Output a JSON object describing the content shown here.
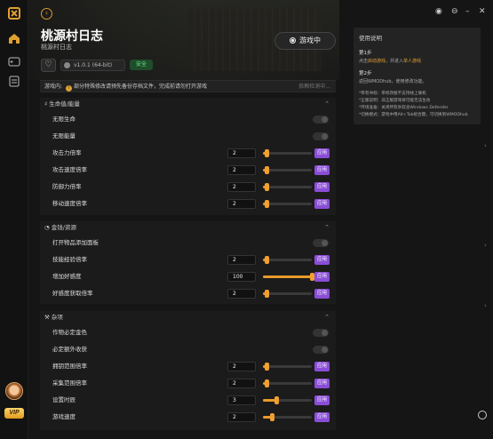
{
  "app": {
    "title": "桃源村日志",
    "subtitle": "桃源村日志",
    "play_button": "游戏中",
    "version": "v1.0.1 (64-bit)",
    "secure_badge": "安全",
    "vip_label": "VIP"
  },
  "notice": {
    "label": "游戏内:",
    "text": "部分特殊修改请预先备份存档文件，完成前请勿打开游戏",
    "status": "依赖检测中..."
  },
  "sections": [
    {
      "title": "生命值/能量",
      "rows": [
        {
          "label": "无限生命",
          "type": "toggle"
        },
        {
          "label": "无限能量",
          "type": "toggle"
        },
        {
          "label": "攻击力倍率",
          "type": "slider",
          "value": "2",
          "fraction": 0.08,
          "apply": "应用"
        },
        {
          "label": "攻击速度倍率",
          "type": "slider",
          "value": "2",
          "fraction": 0.08,
          "apply": "应用"
        },
        {
          "label": "防御力倍率",
          "type": "slider",
          "value": "2",
          "fraction": 0.08,
          "apply": "应用"
        },
        {
          "label": "移动速度倍率",
          "type": "slider",
          "value": "2",
          "fraction": 0.08,
          "apply": "应用"
        }
      ]
    },
    {
      "title": "金钱/资源",
      "rows": [
        {
          "label": "打开物品添加面板",
          "type": "toggle"
        },
        {
          "label": "技能经验倍率",
          "type": "slider",
          "value": "2",
          "fraction": 0.08,
          "apply": "应用"
        },
        {
          "label": "增加好感度",
          "type": "slider",
          "value": "100",
          "fraction": 1.0,
          "apply": "应用"
        },
        {
          "label": "好感度获取倍率",
          "type": "slider",
          "value": "2",
          "fraction": 0.08,
          "apply": "应用"
        }
      ]
    },
    {
      "title": "杂项",
      "rows": [
        {
          "label": "作物必定金色",
          "type": "toggle"
        },
        {
          "label": "必定额外收获",
          "type": "toggle"
        },
        {
          "label": "拥钥范围倍率",
          "type": "slider",
          "value": "2",
          "fraction": 0.08,
          "apply": "应用"
        },
        {
          "label": "采集范围倍率",
          "type": "slider",
          "value": "2",
          "fraction": 0.08,
          "apply": "应用"
        },
        {
          "label": "设置时辰",
          "type": "slider",
          "value": "3",
          "fraction": 0.28,
          "apply": "应用"
        },
        {
          "label": "游戏速度",
          "type": "slider",
          "value": "2",
          "fraction": 0.18,
          "apply": "应用"
        }
      ]
    }
  ],
  "help": {
    "title": "使用说明",
    "step1": "第1步",
    "step1_text_a": "点击",
    "step1_link": "启动游戏",
    "step1_text_b": "，并进入",
    "step1_link2": "单人游戏",
    "step2": "第2步",
    "step2_text": "返回WMODhub，使用修改功能。",
    "tips": [
      "*带有书标：带修改版不支持线上联机",
      "*正版说明：非正版游戏将可能无法生效",
      "*环境准备：关闭所有杀软含Windows Defender",
      "*切换模式：游戏中用Alt+Tab组合键，可切换到WMODhub"
    ]
  },
  "icons": {
    "logo": "app-logo-icon",
    "back": "back-arrow-icon",
    "home": "home-icon",
    "game": "gamepad-icon",
    "library": "library-icon",
    "heart": "heart-icon",
    "play": "play-circle-icon",
    "headset": "headset-icon"
  },
  "colors": {
    "accent_orange": "#e89a2a",
    "accent_purple": "#8a4dd6",
    "secure_green": "#6be08a"
  }
}
